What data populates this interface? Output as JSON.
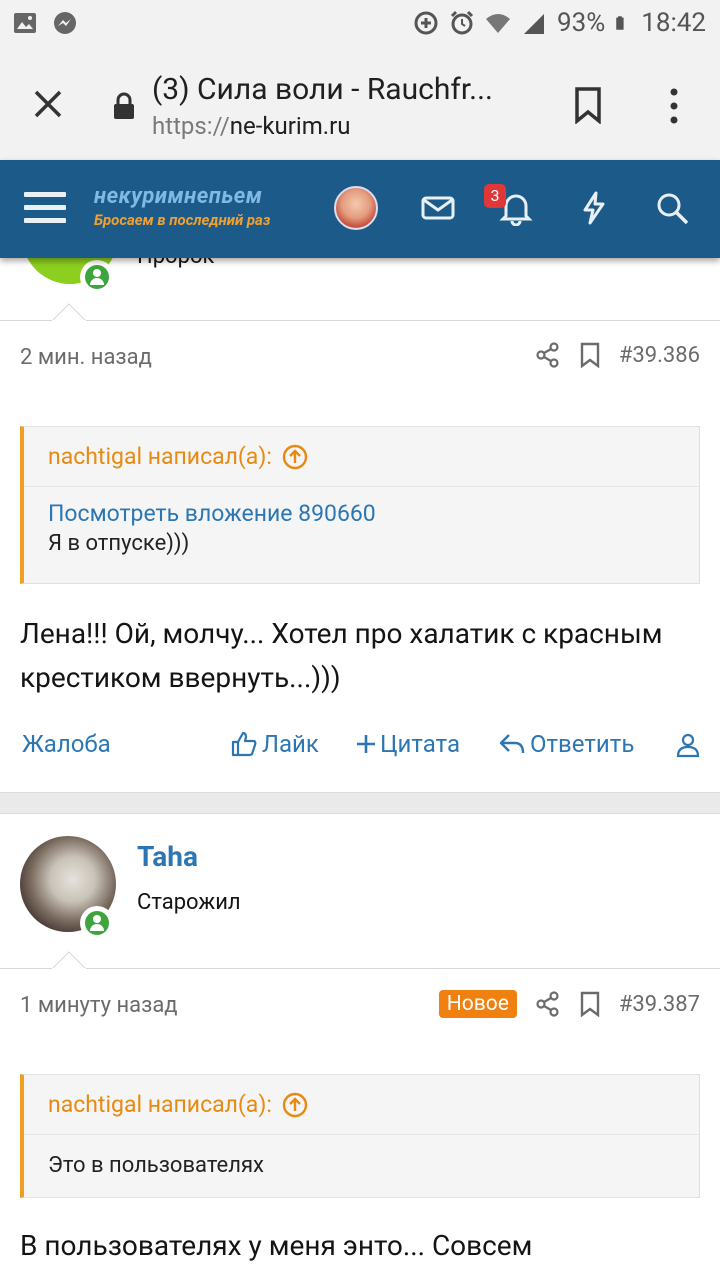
{
  "statusbar": {
    "battery_text": "93%",
    "time": "18:42"
  },
  "browser": {
    "tab_title": "(3) Сила воли - Rauchfr...",
    "url_protocol": "https://",
    "url_host": "ne-kurim.ru"
  },
  "forum_header": {
    "logo_line1": "некуримнепьем",
    "logo_line2": "Бросаем в последний раз",
    "notification_count": "3"
  },
  "post_prev": {
    "rank_partial": "Пророк",
    "time": "2 мин. назад",
    "post_number": "#39.386",
    "quote": {
      "author": "nachtigal написал(а):",
      "link": "Посмотреть вложение 890660",
      "text": "Я в отпуске)))"
    },
    "body": "Лена!!! Ой, молчу... Хотел про халатик с красным крестиком ввернуть...)))",
    "actions": {
      "report": "Жалоба",
      "like": "Лайк",
      "quote": "Цитата",
      "reply": "Ответить"
    }
  },
  "post_next": {
    "username": "Taha",
    "rank": "Старожил",
    "time": "1 минуту назад",
    "new_label": "Новое",
    "post_number": "#39.387",
    "quote": {
      "author": "nachtigal написал(а):",
      "text": "Это в пользователях"
    },
    "body": "В пользователях у меня энто... Совсем"
  }
}
